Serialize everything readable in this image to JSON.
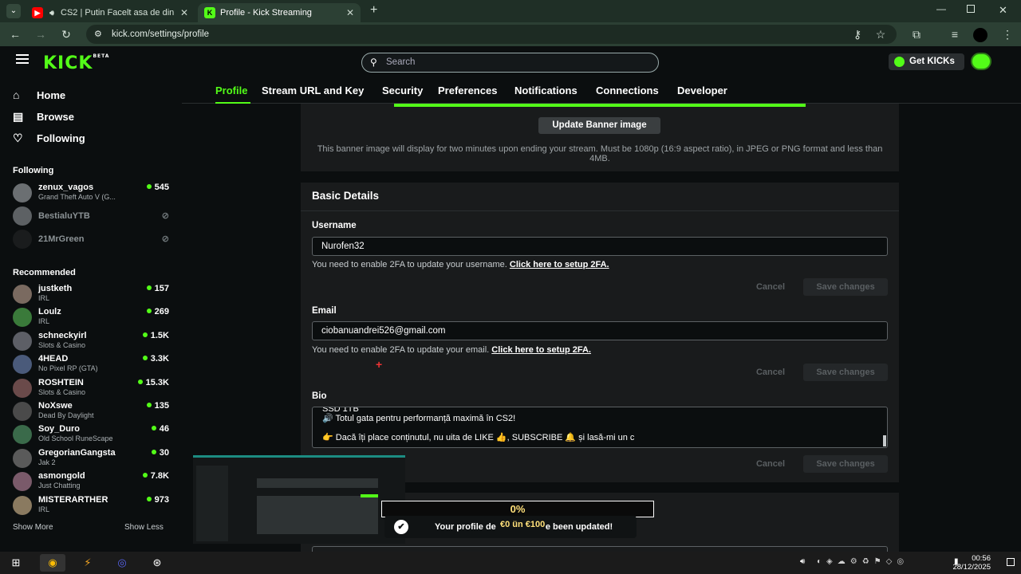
{
  "browser": {
    "tabs": [
      {
        "title": "CS2 | Putin Facelt asa de din",
        "active": false
      },
      {
        "title": "Profile - Kick Streaming",
        "active": true
      }
    ],
    "url": "kick.com/settings/profile",
    "new_tab": "+"
  },
  "header": {
    "logo": "KICK",
    "logo_badge": "BETA",
    "search_placeholder": "Search",
    "get_kicks": "Get KICKs"
  },
  "sidebar": {
    "nav": [
      {
        "label": "Home",
        "icon": "home-icon"
      },
      {
        "label": "Browse",
        "icon": "browse-icon"
      },
      {
        "label": "Following",
        "icon": "heart-icon"
      }
    ],
    "following_title": "Following",
    "following": [
      {
        "name": "zenux_vagos",
        "category": "Grand Theft Auto V (G...",
        "viewers": "545",
        "live": true
      },
      {
        "name": "BestialuYTB",
        "category": "",
        "viewers": "",
        "live": false
      },
      {
        "name": "21MrGreen",
        "category": "",
        "viewers": "",
        "live": false
      }
    ],
    "recommended_title": "Recommended",
    "recommended": [
      {
        "name": "justketh",
        "category": "IRL",
        "viewers": "157"
      },
      {
        "name": "Loulz",
        "category": "IRL",
        "viewers": "269"
      },
      {
        "name": "schneckyirl",
        "category": "Slots & Casino",
        "viewers": "1.5K"
      },
      {
        "name": "4HEAD",
        "category": "No Pixel RP (GTA)",
        "viewers": "3.3K"
      },
      {
        "name": "ROSHTEIN",
        "category": "Slots & Casino",
        "viewers": "15.3K"
      },
      {
        "name": "NoXswe",
        "category": "Dead By Daylight",
        "viewers": "135"
      },
      {
        "name": "Soy_Duro",
        "category": "Old School RuneScape",
        "viewers": "46"
      },
      {
        "name": "GregorianGangsta",
        "category": "Jak 2",
        "viewers": "30"
      },
      {
        "name": "asmongold",
        "category": "Just Chatting",
        "viewers": "7.8K"
      },
      {
        "name": "MISTERARTHER",
        "category": "IRL",
        "viewers": "973"
      }
    ],
    "show_more": "Show More",
    "show_less": "Show Less"
  },
  "settings_tabs": [
    "Profile",
    "Stream URL and Key",
    "Security",
    "Preferences",
    "Notifications",
    "Connections",
    "Developer"
  ],
  "banner": {
    "update_button": "Update Banner image",
    "note": "This banner image will display for two minutes upon ending your stream. Must be 1080p (16:9 aspect ratio), in JPEG or PNG format and less than 4MB."
  },
  "basic_details": {
    "title": "Basic Details",
    "username_label": "Username",
    "username_value": "Nurofen32",
    "username_note": "You need to enable 2FA to update your username.",
    "setup_2fa_link": "Click here to setup 2FA.",
    "cancel": "Cancel",
    "save": "Save changes",
    "email_label": "Email",
    "email_value": "ciobanuandrei526@gmail.com",
    "email_note": "You need to enable 2FA to update your email.",
    "bio_label": "Bio",
    "bio_lines": [
      "SSD 1TB",
      "🔊 Totul gata pentru performanță maximă în CS2!",
      "",
      "👉 Dacă îți place conținutul, nu uita de LIKE 👍, SUBSCRIBE 🔔 și lasă-mi un c"
    ]
  },
  "overlay": {
    "progress": "0%",
    "toast": "Your profile de",
    "toast_tail": "e been updated!",
    "toast_overlap": "€0 ün €100"
  },
  "taskbar": {
    "time": "00:56",
    "date": "28/12/2025"
  }
}
